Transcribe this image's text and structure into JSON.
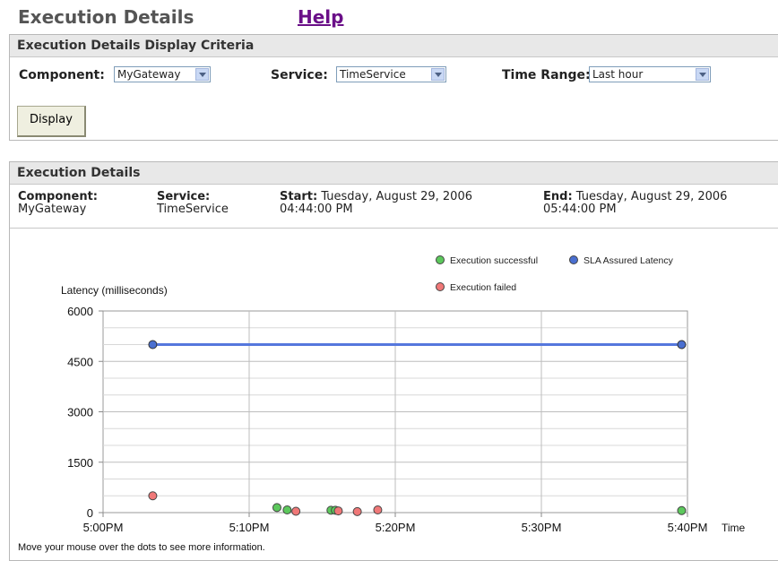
{
  "page": {
    "title": "Execution Details",
    "help": "Help"
  },
  "criteria": {
    "header": "Execution Details Display Criteria",
    "component_label": "Component:",
    "component_value": "MyGateway",
    "service_label": "Service:",
    "service_value": "TimeService",
    "time_range_label": "Time Range:",
    "time_range_value": "Last hour",
    "display_button": "Display"
  },
  "details": {
    "header": "Execution Details",
    "component_label": "Component:",
    "component_value": "MyGateway",
    "service_label": "Service:",
    "service_value": "TimeService",
    "start_label": "Start:",
    "start_date": "Tuesday, August 29, 2006",
    "start_time": "04:44:00 PM",
    "end_label": "End:",
    "end_date": "Tuesday, August 29, 2006",
    "end_time": "05:44:00 PM",
    "hint": "Move your mouse over the dots to see more information."
  },
  "colors": {
    "success": "#5cc85c",
    "sla": "#4a6fd0",
    "failed": "#f07878",
    "sla_line": "#5577dd",
    "title_gray": "#555555",
    "help_link": "#6a0f88"
  },
  "chart_data": {
    "type": "scatter",
    "ylabel": "Latency (milliseconds)",
    "xlabel": "Time",
    "ylim": [
      0,
      6000
    ],
    "yticks": [
      "0",
      "1500",
      "3000",
      "4500",
      "6000"
    ],
    "xlim_minutes": [
      0,
      40
    ],
    "xticks": [
      "5:00PM",
      "5:10PM",
      "5:20PM",
      "5:30PM",
      "5:40PM"
    ],
    "grid": true,
    "legend": [
      "Execution successful",
      "SLA Assured Latency",
      "Execution failed"
    ],
    "series": [
      {
        "name": "SLA Assured Latency",
        "kind": "line",
        "points": [
          {
            "t": 3.4,
            "y": 5000
          },
          {
            "t": 39.6,
            "y": 5000
          }
        ]
      },
      {
        "name": "Execution successful",
        "kind": "dots",
        "points": [
          {
            "t": 11.9,
            "y": 150
          },
          {
            "t": 12.6,
            "y": 80
          },
          {
            "t": 15.6,
            "y": 70
          },
          {
            "t": 15.9,
            "y": 70
          },
          {
            "t": 39.6,
            "y": 60
          }
        ]
      },
      {
        "name": "Execution failed",
        "kind": "dots",
        "points": [
          {
            "t": 3.4,
            "y": 500
          },
          {
            "t": 13.2,
            "y": 40
          },
          {
            "t": 16.1,
            "y": 50
          },
          {
            "t": 17.4,
            "y": 30
          },
          {
            "t": 18.8,
            "y": 80
          }
        ]
      }
    ]
  }
}
